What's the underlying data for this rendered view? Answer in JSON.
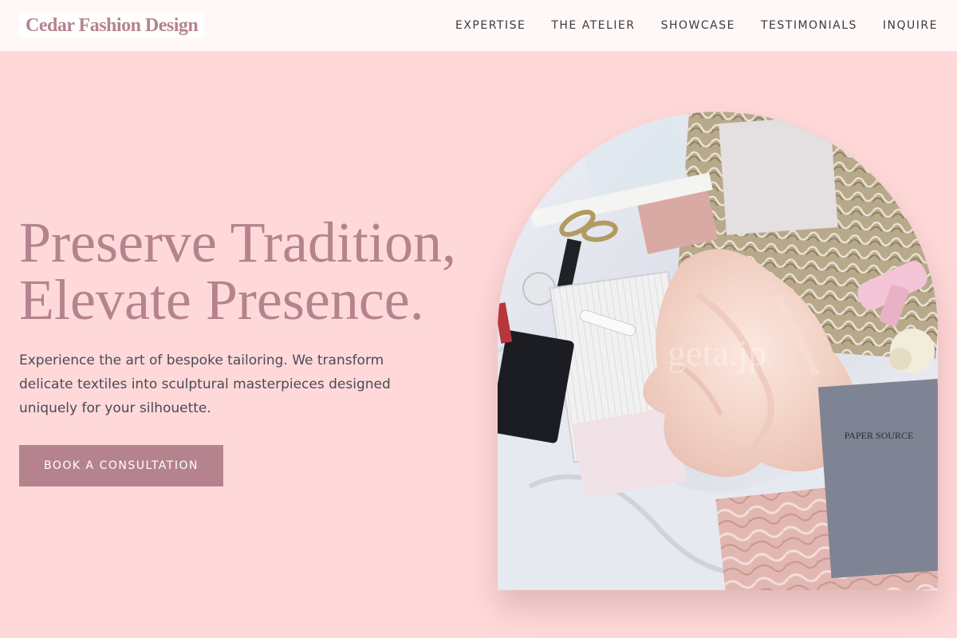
{
  "brand": {
    "name": "Cedar Fashion Design"
  },
  "nav": {
    "items": [
      {
        "label": "EXPERTISE"
      },
      {
        "label": "THE ATELIER"
      },
      {
        "label": "SHOWCASE"
      },
      {
        "label": "TESTIMONIALS"
      },
      {
        "label": "INQUIRE"
      }
    ]
  },
  "hero": {
    "title_line1": "Preserve Tradition,",
    "title_line2": "Elevate Presence.",
    "subtitle": "Experience the art of bespoke tailoring. We transform delicate textiles into sculptural masterpieces designed uniquely for your silhouette.",
    "cta_label": "BOOK A CONSULTATION"
  },
  "hero_image": {
    "watermark": "geta.jp",
    "envelope_text": "PAPER SOURCE"
  },
  "colors": {
    "background": "#ffd9d9",
    "navbar": "#fff8f7",
    "accent": "#b5838d",
    "text": "#3a3a44"
  }
}
